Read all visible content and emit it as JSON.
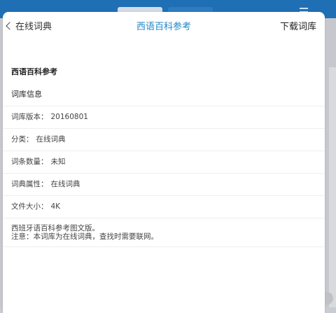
{
  "header": {
    "back_label": "在线词典",
    "title": "西语百科参考",
    "download_label": "下载词库"
  },
  "dictionary_name": "西语百科参考",
  "info": {
    "section_title": "词库信息",
    "rows": [
      {
        "label": "词库版本：",
        "value": "20160801"
      },
      {
        "label": "分类：",
        "value": "在线词典"
      },
      {
        "label": "词条数量：",
        "value": "未知"
      },
      {
        "label": "词典属性：",
        "value": "在线词典"
      },
      {
        "label": "文件大小：",
        "value": "4K"
      }
    ],
    "description_line1": "西班牙语百科参考图文版。",
    "description_line2": "注意：本词库为在线词典，查找时需要联网。"
  },
  "colors": {
    "accent": "#1e87c8",
    "topbar": "#1f6fb5"
  }
}
